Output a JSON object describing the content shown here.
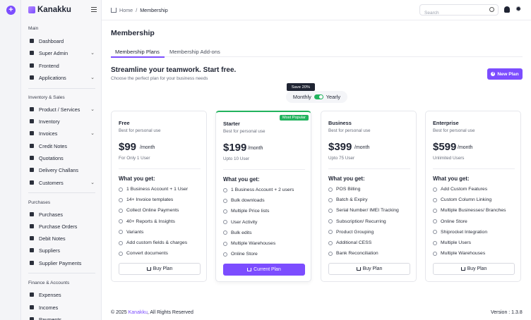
{
  "app": {
    "name": "Kanakku"
  },
  "sidebar": {
    "sections": [
      {
        "title": "Main",
        "items": [
          {
            "label": "Dashboard",
            "icon": "dashboard-icon",
            "has_children": false
          },
          {
            "label": "Super Admin",
            "icon": "super-admin-icon",
            "has_children": true
          },
          {
            "label": "Frontend",
            "icon": "frontend-icon",
            "has_children": false
          },
          {
            "label": "Applications",
            "icon": "applications-icon",
            "has_children": true
          }
        ]
      },
      {
        "title": "Inventory & Sales",
        "items": [
          {
            "label": "Product / Services",
            "icon": "product-icon",
            "has_children": true
          },
          {
            "label": "Inventory",
            "icon": "inventory-icon",
            "has_children": false
          },
          {
            "label": "Invoices",
            "icon": "invoices-icon",
            "has_children": true
          },
          {
            "label": "Credit Notes",
            "icon": "credit-notes-icon",
            "has_children": false
          },
          {
            "label": "Quotations",
            "icon": "quotations-icon",
            "has_children": false
          },
          {
            "label": "Delivery Challans",
            "icon": "delivery-challans-icon",
            "has_children": false
          },
          {
            "label": "Customers",
            "icon": "customers-icon",
            "has_children": true
          }
        ]
      },
      {
        "title": "Purchases",
        "items": [
          {
            "label": "Purchases",
            "icon": "purchases-icon",
            "has_children": false
          },
          {
            "label": "Purchase Orders",
            "icon": "purchase-orders-icon",
            "has_children": false
          },
          {
            "label": "Debit Notes",
            "icon": "debit-notes-icon",
            "has_children": false
          },
          {
            "label": "Suppliers",
            "icon": "suppliers-icon",
            "has_children": false
          },
          {
            "label": "Supplier Payments",
            "icon": "supplier-payments-icon",
            "has_children": false
          }
        ]
      },
      {
        "title": "Finance & Accounts",
        "items": [
          {
            "label": "Expenses",
            "icon": "expenses-icon",
            "has_children": false
          },
          {
            "label": "Incomes",
            "icon": "incomes-icon",
            "has_children": false
          },
          {
            "label": "Payments",
            "icon": "payments-icon",
            "has_children": false
          }
        ]
      }
    ]
  },
  "header": {
    "breadcrumb": {
      "home": "Home",
      "separator": "/",
      "current": "Membership"
    },
    "search_placeholder": "Search"
  },
  "page": {
    "title": "Membership",
    "tabs": [
      {
        "label": "Membership Plans",
        "active": true
      },
      {
        "label": "Membership Add-ons",
        "active": false
      }
    ],
    "hero_title": "Streamline your teamwork. Start free.",
    "hero_subtitle": "Choose the perfect plan for your business needs",
    "new_plan_label": "New Plan",
    "save_badge": "Save 20%",
    "billing": {
      "monthly": "Monthly",
      "yearly": "Yearly",
      "yearly_selected": true
    }
  },
  "plans": [
    {
      "name": "Free",
      "desc": "Best for personal use",
      "price": "$99",
      "period": "/month",
      "users": "For Only 1 User",
      "features_title": "What you get:",
      "features": [
        "1 Business Account + 1 User",
        "14+ Invoice templates",
        "Collect Online Payments",
        "40+ Reports & Insights",
        "Variants",
        "Add custom fields & charges",
        "Convert documents"
      ],
      "button": "Buy Plan",
      "featured": false,
      "badge": ""
    },
    {
      "name": "Starter",
      "desc": "Best for personal use",
      "price": "$199",
      "period": "/month",
      "users": "Upto 10 User",
      "features_title": "What you get:",
      "features": [
        "1 Business Account + 2 users",
        "Bulk downloads",
        "Multiple Price lists",
        "User Activity",
        "Bulk edits",
        "Multiple Warehouses",
        "Online Store"
      ],
      "button": "Current Plan",
      "featured": true,
      "badge": "Most Popular"
    },
    {
      "name": "Business",
      "desc": "Best for personal use",
      "price": "$399",
      "period": "/month",
      "users": "Upto 75 User",
      "features_title": "What you get:",
      "features": [
        "POS Billing",
        "Batch & Expiry",
        "Serial Number/ IMEI Tracking",
        "Subscription/ Recurring",
        "Product Grouping",
        "Additional CESS",
        "Bank Reconciliation"
      ],
      "button": "Buy Plan",
      "featured": false,
      "badge": ""
    },
    {
      "name": "Enterprise",
      "desc": "Best for personal use",
      "price": "$599",
      "period": "/month",
      "users": "Unlimited Users",
      "features_title": "What you get:",
      "features": [
        "Add Custom Features",
        "Custom Column Linking",
        "Multiple Businesses/ Branches",
        "Online Store",
        "Shiprocket Integration",
        "Multiple Users",
        "Multiple Warehouses"
      ],
      "button": "Buy Plan",
      "featured": false,
      "badge": ""
    }
  ],
  "footer": {
    "copyright_prefix": "© 2025 ",
    "brand": "Kanakku",
    "copyright_suffix": ", All Rights Reserved",
    "version": "Version : 1.3.8"
  },
  "colors": {
    "accent": "#7c4dff",
    "success": "#22b35e",
    "text": "#1f2433",
    "muted": "#6a6f7d"
  }
}
